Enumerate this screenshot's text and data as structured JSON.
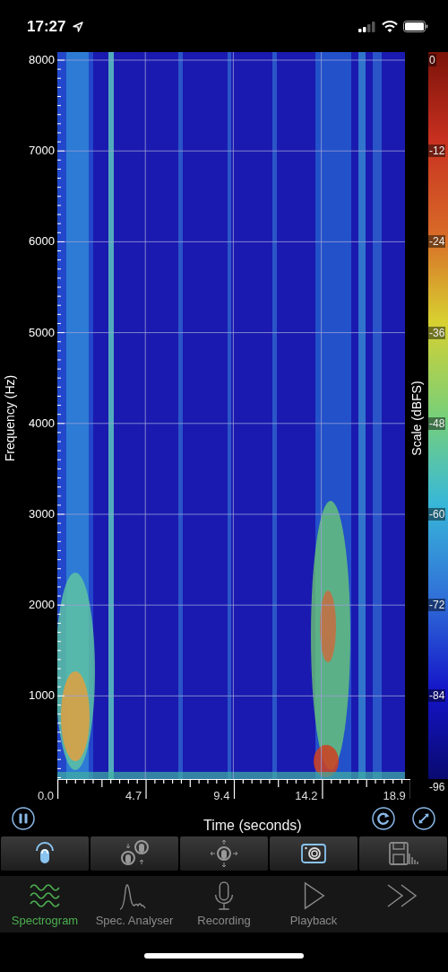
{
  "status_bar": {
    "time": "17:27"
  },
  "chart": {
    "y_axis_title": "Frequency (Hz)",
    "y_labels": [
      "8000",
      "7000",
      "6000",
      "5000",
      "4000",
      "3000",
      "2000",
      "1000"
    ],
    "x_labels": [
      "0.0",
      "4.7",
      "9.4",
      "14.2",
      "18.9"
    ],
    "x_axis_title": "Time (seconds)",
    "scale_title": "Scale (dBFS)",
    "scale_labels": [
      "0",
      "-12",
      "-24",
      "-36",
      "-48",
      "-60",
      "-72",
      "-84",
      "-96"
    ]
  },
  "toolbar": [
    {
      "kind": "touch"
    },
    {
      "kind": "pinch"
    },
    {
      "kind": "pan"
    },
    {
      "kind": "camera"
    },
    {
      "kind": "save"
    }
  ],
  "tabs": [
    {
      "kind": "spectrogram",
      "label": "Spectrogram",
      "selected": true
    },
    {
      "kind": "analyser",
      "label": "Spec. Analyser",
      "selected": false
    },
    {
      "kind": "recording",
      "label": "Recording",
      "selected": false
    },
    {
      "kind": "playback",
      "label": "Playback",
      "selected": false
    },
    {
      "kind": "more",
      "selected": false
    }
  ]
}
